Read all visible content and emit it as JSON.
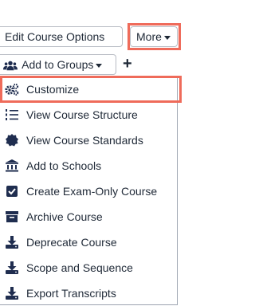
{
  "toolbar": {
    "edit_course_options_label": "Edit Course Options",
    "more_label": "More",
    "add_to_groups_label": "Add to Groups",
    "add_label": "+"
  },
  "menu": {
    "items": [
      {
        "label": "Customize",
        "icon": "gears-icon"
      },
      {
        "label": "View Course Structure",
        "icon": "list-ordered-icon"
      },
      {
        "label": "View Course Standards",
        "icon": "certificate-icon"
      },
      {
        "label": "Add to Schools",
        "icon": "university-icon"
      },
      {
        "label": "Create Exam-Only Course",
        "icon": "checkbox-icon"
      },
      {
        "label": "Archive Course",
        "icon": "archive-icon"
      },
      {
        "label": "Deprecate Course",
        "icon": "download-icon"
      },
      {
        "label": "Scope and Sequence",
        "icon": "download-icon"
      },
      {
        "label": "Export Transcripts",
        "icon": "download-icon"
      }
    ]
  },
  "colors": {
    "highlight": "#ef6b5a",
    "icon": "#1f2d4f",
    "text": "#1f2937"
  }
}
